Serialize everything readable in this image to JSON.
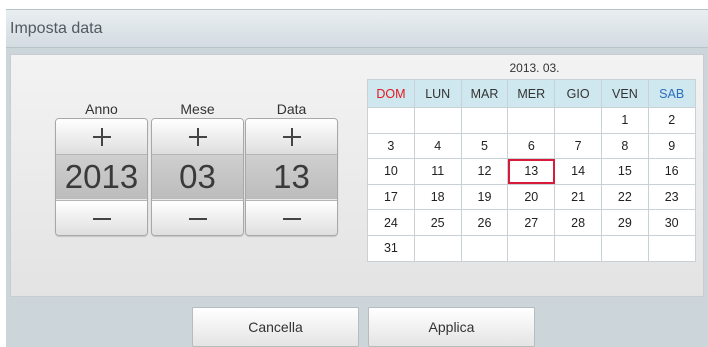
{
  "dialog": {
    "title": "Imposta data"
  },
  "spinners": [
    {
      "label": "Anno",
      "value": "2013"
    },
    {
      "label": "Mese",
      "value": "03"
    },
    {
      "label": "Data",
      "value": "13"
    }
  ],
  "calendar": {
    "month_label": "2013. 03.",
    "weekdays": [
      "DOM",
      "LUN",
      "MAR",
      "MER",
      "GIO",
      "VEN",
      "SAB"
    ],
    "weekday_colors": {
      "sunday": "#e0191f",
      "saturday": "#2a6fc2"
    },
    "weeks": [
      [
        "",
        "",
        "",
        "",
        "",
        "1",
        "2"
      ],
      [
        "3",
        "4",
        "5",
        "6",
        "7",
        "8",
        "9"
      ],
      [
        "10",
        "11",
        "12",
        "13",
        "14",
        "15",
        "16"
      ],
      [
        "17",
        "18",
        "19",
        "20",
        "21",
        "22",
        "23"
      ],
      [
        "24",
        "25",
        "26",
        "27",
        "28",
        "29",
        "30"
      ],
      [
        "31",
        "",
        "",
        "",
        "",
        "",
        ""
      ]
    ],
    "selected_day": "13",
    "selected_color": "#d81b3b"
  },
  "footer": {
    "cancel_label": "Cancella",
    "apply_label": "Applica"
  },
  "icons": {
    "increment": "plus-icon",
    "decrement": "minus-icon"
  }
}
